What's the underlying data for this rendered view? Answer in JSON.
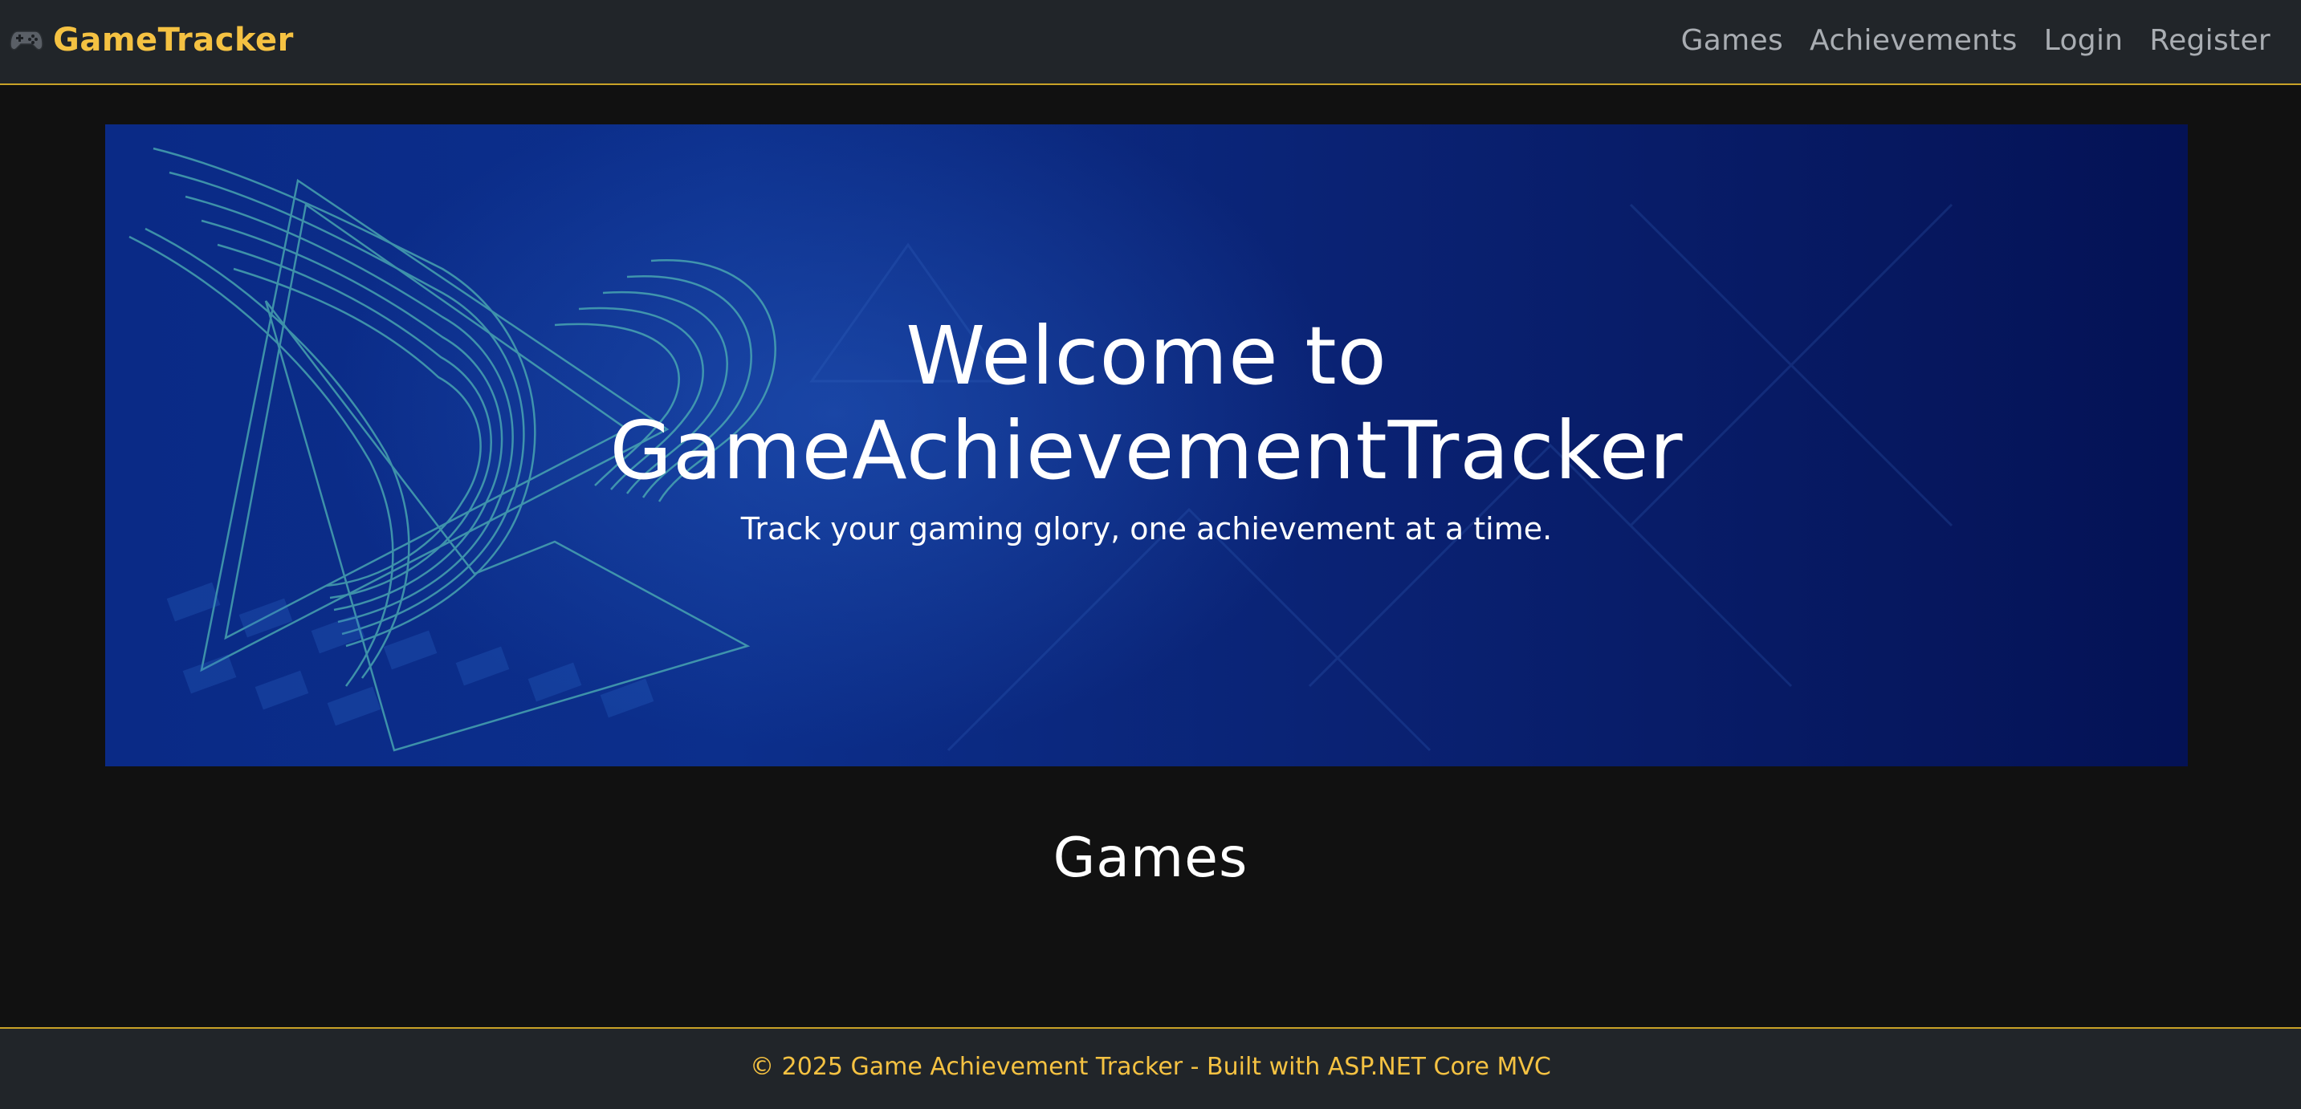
{
  "navbar": {
    "brand_icon": "gamepad-icon",
    "brand_text": "GameTracker",
    "links": {
      "games": "Games",
      "achievements": "Achievements",
      "login": "Login",
      "register": "Register"
    }
  },
  "hero": {
    "title_line1": "Welcome to",
    "title_line2": "GameAchievementTracker",
    "subtitle": "Track your gaming glory, one achievement at a time."
  },
  "main": {
    "section_title": "Games"
  },
  "footer": {
    "text": "© 2025 Game Achievement Tracker - Built with ASP.NET Core MVC"
  },
  "colors": {
    "background": "#111111",
    "navbar_bg": "#212529",
    "accent_gold": "#f5c242",
    "nav_link": "#a9adb2",
    "hero_blue": "#0a2a86"
  }
}
